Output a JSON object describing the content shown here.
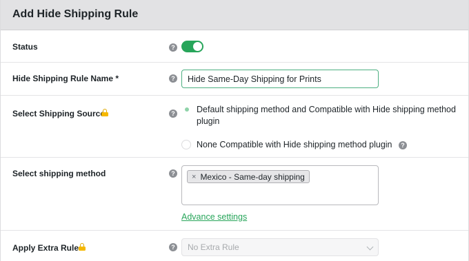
{
  "header": {
    "title": "Add Hide Shipping Rule"
  },
  "rows": {
    "status": {
      "label": "Status",
      "help": "?",
      "enabled": true
    },
    "rule_name": {
      "label": "Hide Shipping Rule Name *",
      "help": "?",
      "value": "Hide Same-Day Shipping for Prints"
    },
    "shipping_source": {
      "label": "Select Shipping Source",
      "help": "?",
      "locked": true,
      "options": [
        {
          "line1": "Default shipping method and Compatible with Hide shipping method",
          "line2": "plugin",
          "selected": true
        },
        {
          "line1": "None Compatible with Hide shipping method plugin",
          "selected": false,
          "help": "?"
        }
      ]
    },
    "shipping_method": {
      "label": "Select shipping method",
      "help": "?",
      "tags": [
        {
          "remove": "×",
          "text": "Mexico - Same-day shipping"
        }
      ],
      "advance_link": "Advance settings"
    },
    "extra_rule": {
      "label": "Apply Extra Rule",
      "help": "?",
      "locked": true,
      "selected": "No Extra Rule",
      "disabled": true
    }
  },
  "colors": {
    "accent_green": "#27a55a",
    "header_bg": "#e2e2e4",
    "lock": "#f5b800",
    "help_icon": "#8c8f94"
  },
  "icons": {
    "help": "help-circle-icon",
    "lock": "lock-icon",
    "remove": "close-icon",
    "chevron": "chevron-down-icon"
  }
}
